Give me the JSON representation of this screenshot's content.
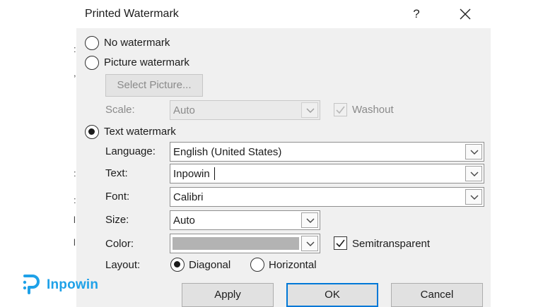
{
  "dialog": {
    "title": "Printed Watermark",
    "help_label": "?"
  },
  "options": {
    "no_watermark": "No watermark",
    "picture_watermark": "Picture watermark",
    "text_watermark": "Text watermark"
  },
  "picture": {
    "select_button": "Select Picture...",
    "scale_label": "Scale:",
    "scale_value": "Auto",
    "washout_label": "Washout",
    "washout_checked": true
  },
  "text_settings": {
    "language_label": "Language:",
    "language_value": "English (United States)",
    "text_label": "Text:",
    "text_value": "Inpowin",
    "font_label": "Font:",
    "font_value": "Calibri",
    "size_label": "Size:",
    "size_value": "Auto",
    "color_label": "Color:",
    "color_value": "#b3b3b3",
    "semitransparent_label": "Semitransparent",
    "semitransparent_checked": true,
    "layout_label": "Layout:",
    "diagonal_label": "Diagonal",
    "horizontal_label": "Horizontal",
    "layout_selected": "Diagonal"
  },
  "buttons": {
    "apply": "Apply",
    "ok": "OK",
    "cancel": "Cancel"
  },
  "watermark_logo": {
    "text": "Inpowin",
    "color": "#1ea1e8"
  },
  "icons": {
    "close": "close-icon",
    "dropdown": "chevron-down-icon",
    "check": "checkmark-icon",
    "logo": "inpowin-logo-icon"
  }
}
